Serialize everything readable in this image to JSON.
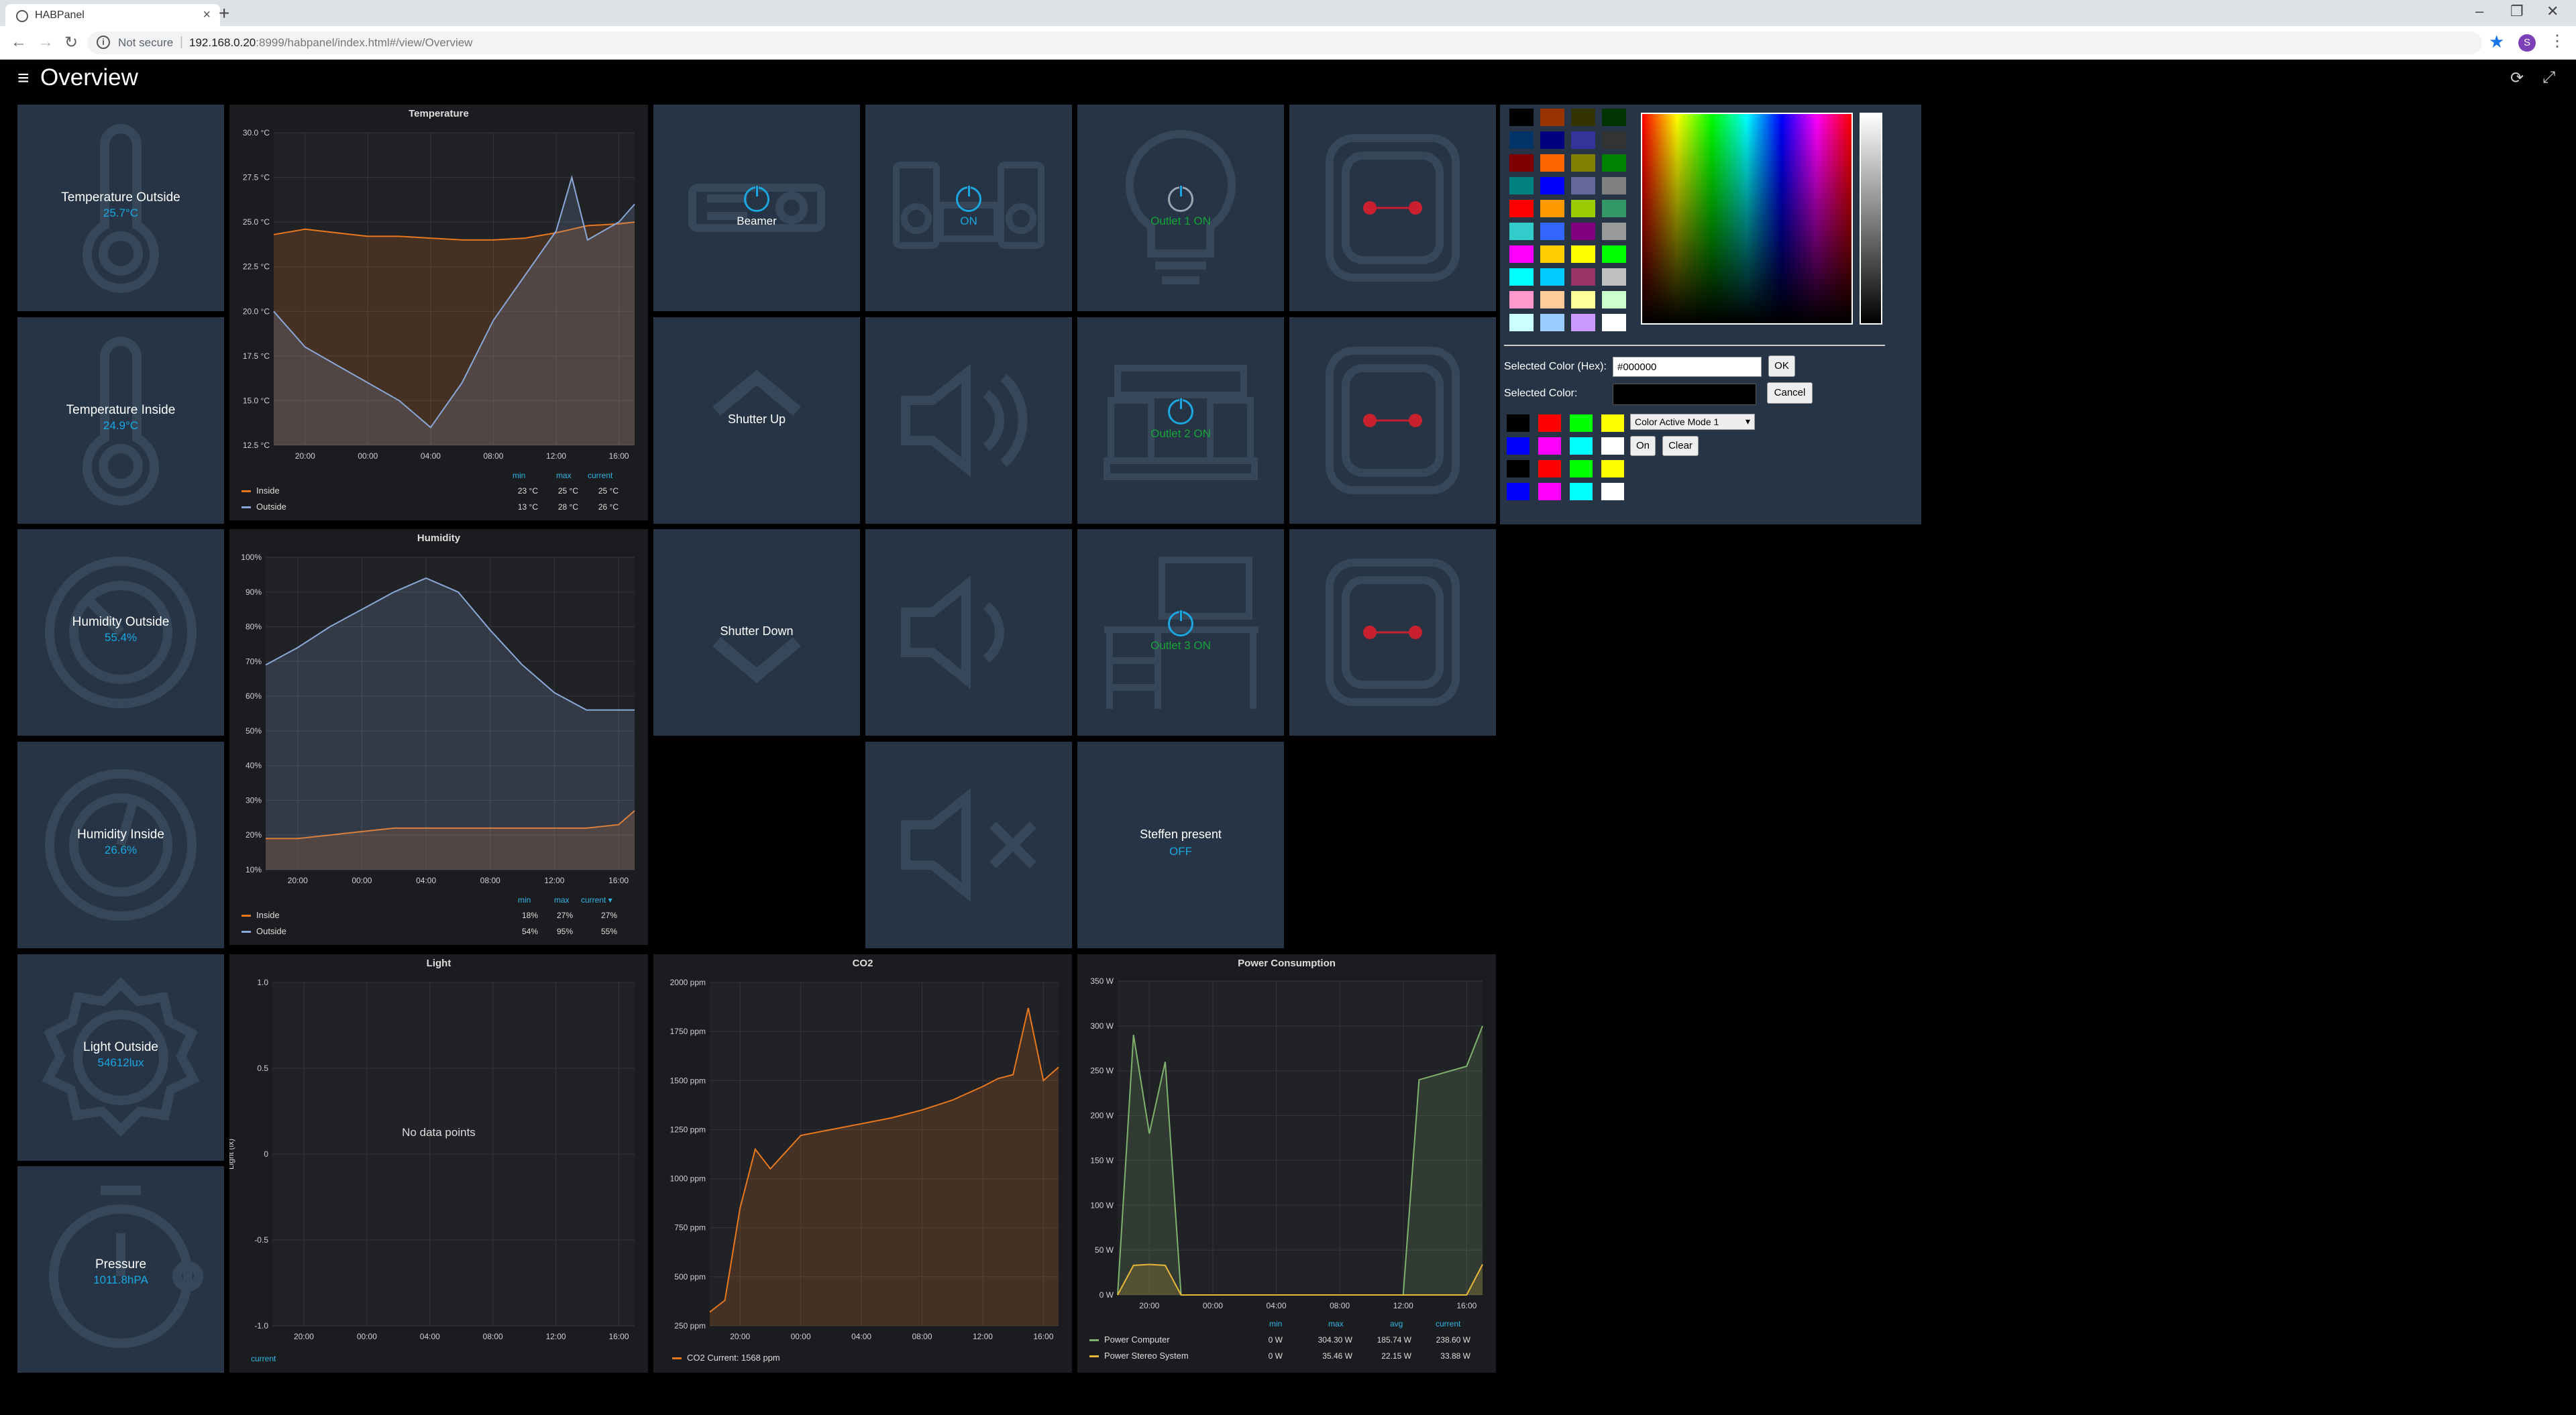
{
  "browser": {
    "tab_title": "HABPanel",
    "not_secure": "Not secure",
    "url_host": "192.168.0.20",
    "url_rest": ":8999/habpanel/index.html#/view/Overview",
    "profile_letter": "S"
  },
  "header": {
    "title": "Overview"
  },
  "tiles": {
    "temp_outside": {
      "label": "Temperature Outside",
      "value": "25.7°C"
    },
    "temp_inside": {
      "label": "Temperature Inside",
      "value": "24.9°C"
    },
    "hum_outside": {
      "label": "Humidity Outside",
      "value": "55.4%"
    },
    "hum_inside": {
      "label": "Humidity Inside",
      "value": "26.6%"
    },
    "light_outside": {
      "label": "Light Outside",
      "value": "54612lux"
    },
    "pressure": {
      "label": "Pressure",
      "value": "1011.8hPA"
    },
    "beamer": {
      "label": "Beamer"
    },
    "speakers": {
      "status": "ON"
    },
    "outlet1": {
      "status": "Outlet 1 ON"
    },
    "outlet2": {
      "status": "Outlet 2 ON"
    },
    "outlet3": {
      "status": "Outlet 3 ON"
    },
    "shutter_up": {
      "label": "Shutter Up"
    },
    "shutter_down": {
      "label": "Shutter Down"
    },
    "presence": {
      "label": "Steffen present",
      "value": "OFF"
    }
  },
  "charts": {
    "temperature": {
      "title": "Temperature",
      "yticks": [
        "30.0 °C",
        "27.5 °C",
        "25.0 °C",
        "22.5 °C",
        "20.0 °C",
        "17.5 °C",
        "15.0 °C",
        "12.5 °C"
      ],
      "xticks": [
        "20:00",
        "00:00",
        "04:00",
        "08:00",
        "12:00",
        "16:00"
      ],
      "legend_head": [
        "min",
        "max",
        "current"
      ],
      "rows": [
        {
          "name": "Inside",
          "color": "#e8781e",
          "min": "23 °C",
          "max": "25 °C",
          "current": "25 °C"
        },
        {
          "name": "Outside",
          "color": "#8aa8d8",
          "min": "13 °C",
          "max": "28 °C",
          "current": "26 °C"
        }
      ]
    },
    "humidity": {
      "title": "Humidity",
      "yticks": [
        "100%",
        "90%",
        "80%",
        "70%",
        "60%",
        "50%",
        "40%",
        "30%",
        "20%",
        "10%"
      ],
      "xticks": [
        "20:00",
        "00:00",
        "04:00",
        "08:00",
        "12:00",
        "16:00"
      ],
      "legend_head": [
        "min",
        "max",
        "current ▾"
      ],
      "rows": [
        {
          "name": "Inside",
          "color": "#e8781e",
          "min": "18%",
          "max": "27%",
          "current": "27%"
        },
        {
          "name": "Outside",
          "color": "#8aa8d8",
          "min": "54%",
          "max": "95%",
          "current": "55%"
        }
      ]
    },
    "light": {
      "title": "Light",
      "yticks": [
        "1.0",
        "0.5",
        "0",
        "-0.5",
        "-1.0"
      ],
      "xticks": [
        "20:00",
        "00:00",
        "04:00",
        "08:00",
        "12:00",
        "16:00"
      ],
      "ylabel": "Light (lx)",
      "empty": "No data points",
      "legend_head": "current"
    },
    "co2": {
      "title": "CO2",
      "yticks": [
        "2000 ppm",
        "1750 ppm",
        "1500 ppm",
        "1250 ppm",
        "1000 ppm",
        "750 ppm",
        "500 ppm",
        "250 ppm"
      ],
      "xticks": [
        "20:00",
        "00:00",
        "04:00",
        "08:00",
        "12:00",
        "16:00"
      ],
      "legend": "CO2  Current: 1568 ppm"
    },
    "power": {
      "title": "Power Consumption",
      "yticks": [
        "350 W",
        "300 W",
        "250 W",
        "200 W",
        "150 W",
        "100 W",
        "50 W",
        "0 W"
      ],
      "xticks": [
        "20:00",
        "00:00",
        "04:00",
        "08:00",
        "12:00",
        "16:00"
      ],
      "legend_head": [
        "min",
        "max",
        "avg",
        "current"
      ],
      "rows": [
        {
          "name": "Power Computer",
          "color": "#7eb26d",
          "min": "0 W",
          "max": "304.30 W",
          "avg": "185.74 W",
          "current": "238.60 W"
        },
        {
          "name": "Power Stereo System",
          "color": "#eab839",
          "min": "0 W",
          "max": "35.46 W",
          "avg": "22.15 W",
          "current": "33.88 W"
        }
      ]
    }
  },
  "chart_data": [
    {
      "type": "line",
      "title": "Temperature",
      "x": [
        "18:00",
        "20:00",
        "22:00",
        "00:00",
        "02:00",
        "04:00",
        "06:00",
        "08:00",
        "10:00",
        "12:00",
        "13:00",
        "14:00",
        "16:00",
        "17:00"
      ],
      "series": [
        {
          "name": "Inside",
          "values": [
            24.3,
            24.6,
            24.4,
            24.2,
            24.2,
            24.1,
            24.0,
            24.0,
            24.1,
            24.4,
            24.6,
            24.8,
            24.9,
            25.0
          ]
        },
        {
          "name": "Outside",
          "values": [
            20.0,
            18.0,
            17.0,
            16.0,
            15.0,
            13.5,
            16.0,
            19.5,
            22.0,
            24.5,
            27.5,
            24.0,
            25.0,
            26.0
          ]
        }
      ],
      "ylim": [
        12.5,
        30.0
      ]
    },
    {
      "type": "line",
      "title": "Humidity",
      "x": [
        "18:00",
        "20:00",
        "22:00",
        "00:00",
        "02:00",
        "04:00",
        "06:00",
        "08:00",
        "10:00",
        "12:00",
        "14:00",
        "16:00",
        "17:00"
      ],
      "series": [
        {
          "name": "Inside",
          "values": [
            19,
            19,
            20,
            21,
            22,
            22,
            22,
            22,
            22,
            22,
            22,
            23,
            27
          ]
        },
        {
          "name": "Outside",
          "values": [
            69,
            74,
            80,
            85,
            90,
            94,
            90,
            79,
            69,
            61,
            56,
            56,
            56
          ]
        }
      ],
      "ylim": [
        10,
        100
      ]
    },
    {
      "type": "line",
      "title": "Light",
      "x": [],
      "series": [],
      "ylim": [
        -1.0,
        1.0
      ]
    },
    {
      "type": "area",
      "title": "CO2",
      "x": [
        "18:00",
        "19:00",
        "20:00",
        "21:00",
        "22:00",
        "00:00",
        "02:00",
        "04:00",
        "06:00",
        "08:00",
        "10:00",
        "12:00",
        "13:00",
        "14:00",
        "15:00",
        "16:00",
        "17:00"
      ],
      "series": [
        {
          "name": "CO2",
          "values": [
            320,
            380,
            850,
            1150,
            1050,
            1220,
            1250,
            1280,
            1310,
            1350,
            1400,
            1470,
            1510,
            1530,
            1870,
            1500,
            1568
          ]
        }
      ],
      "ylim": [
        250,
        2000
      ]
    },
    {
      "type": "line",
      "title": "Power Consumption",
      "x": [
        "18:00",
        "19:00",
        "20:00",
        "21:00",
        "22:00",
        "00:00",
        "04:00",
        "08:00",
        "12:00",
        "13:00",
        "14:00",
        "15:00",
        "16:00",
        "17:00"
      ],
      "series": [
        {
          "name": "Power Computer",
          "values": [
            0,
            290,
            180,
            260,
            0,
            0,
            0,
            0,
            0,
            240,
            245,
            250,
            255,
            300
          ]
        },
        {
          "name": "Power Stereo System",
          "values": [
            0,
            33,
            34,
            33,
            0,
            0,
            0,
            0,
            0,
            0,
            0,
            0,
            0,
            34
          ]
        }
      ],
      "ylim": [
        0,
        350
      ]
    }
  ],
  "colorpicker": {
    "hex_label": "Selected Color (Hex):",
    "hex_value": "#000000",
    "selected_label": "Selected Color:",
    "ok": "OK",
    "cancel": "Cancel",
    "mode": "Color Active Mode 1",
    "on": "On",
    "clear": "Clear",
    "palette": [
      [
        "#000000",
        "#993300",
        "#333300",
        "#003300"
      ],
      [
        "#003366",
        "#000080",
        "#333399",
        "#333333"
      ],
      [
        "#800000",
        "#ff6600",
        "#808000",
        "#008000"
      ],
      [
        "#008080",
        "#0000ff",
        "#666699",
        "#808080"
      ],
      [
        "#ff0000",
        "#ff9900",
        "#99cc00",
        "#339966"
      ],
      [
        "#33cccc",
        "#3366ff",
        "#800080",
        "#999999"
      ],
      [
        "#ff00ff",
        "#ffcc00",
        "#ffff00",
        "#00ff00"
      ],
      [
        "#00ffff",
        "#00ccff",
        "#993366",
        "#c0c0c0"
      ],
      [
        "#ff99cc",
        "#ffcc99",
        "#ffff99",
        "#ccffcc"
      ],
      [
        "#ccffff",
        "#99ccff",
        "#cc99ff",
        "#ffffff"
      ]
    ],
    "quick": [
      [
        "#000000",
        "#ff0000",
        "#00ff00",
        "#ffff00"
      ],
      [
        "#0000ff",
        "#ff00ff",
        "#00ffff",
        "#ffffff"
      ],
      [
        "#000000",
        "#ff0000",
        "#00ff00",
        "#ffff00"
      ],
      [
        "#0000ff",
        "#ff00ff",
        "#00ffff",
        "#ffffff"
      ]
    ]
  }
}
